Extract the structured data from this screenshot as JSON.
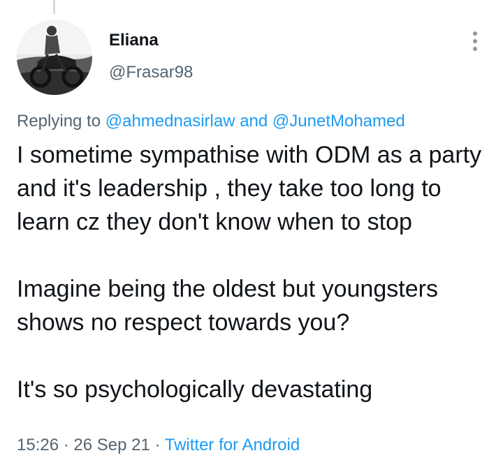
{
  "author": {
    "display_name": "Eliana",
    "handle": "@Frasar98",
    "avatar_icon": "profile-photo-motorbike"
  },
  "reply": {
    "prefix": "Replying to",
    "mention1": "@ahmednasirlaw",
    "joiner": "and",
    "mention2": "@JunetMohamed"
  },
  "tweet": {
    "paragraphs": [
      "I sometime sympathise with ODM as a party and it's leadership , they take too long to learn cz they don't know when to stop",
      "Imagine being the oldest but youngsters shows no respect towards you?",
      "It's so psychologically devastating"
    ]
  },
  "meta": {
    "time": "15:26",
    "separator": "·",
    "date": "26 Sep 21",
    "source": "Twitter for Android"
  },
  "colors": {
    "link": "#1d9bf0",
    "secondary_text": "#536471",
    "primary_text": "#0f1419"
  },
  "icons": {
    "more": "more-options-icon"
  }
}
